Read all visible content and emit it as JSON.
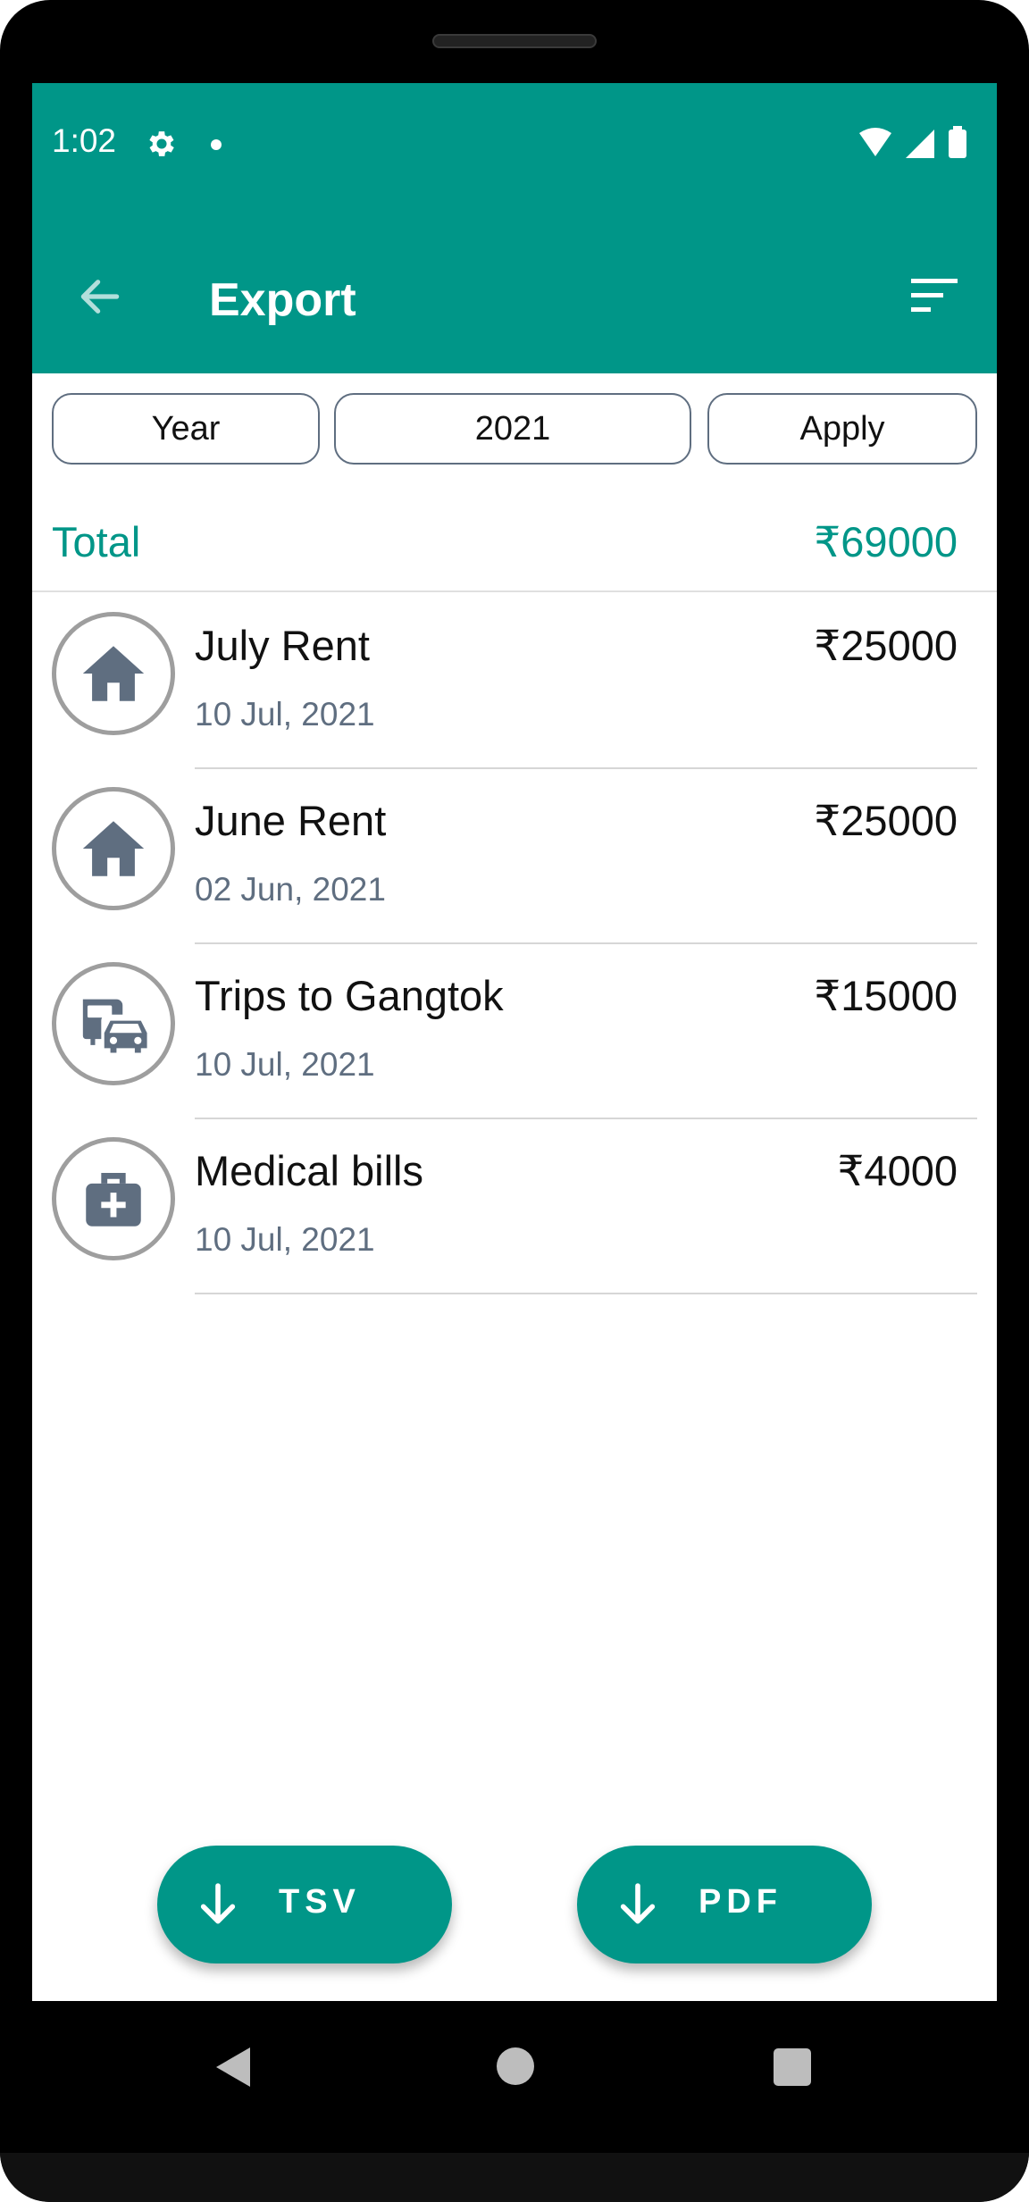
{
  "status_bar": {
    "time": "1:02",
    "icons": [
      "gear-icon",
      "notification-dot-icon",
      "wifi-icon",
      "signal-icon",
      "battery-icon"
    ]
  },
  "app_bar": {
    "title": "Export",
    "back_icon": "arrow-left-icon",
    "sort_icon": "sort-icon"
  },
  "filters": {
    "period": "Year",
    "value": "2021",
    "apply_label": "Apply"
  },
  "summary": {
    "total_label": "Total",
    "total_amount": "₹69000"
  },
  "expenses": [
    {
      "title": "July Rent",
      "date": "10 Jul, 2021",
      "amount": "₹25000",
      "icon": "house-icon"
    },
    {
      "title": "June Rent",
      "date": "02 Jun, 2021",
      "amount": "₹25000",
      "icon": "house-icon"
    },
    {
      "title": "Trips to Gangtok",
      "date": "10 Jul, 2021",
      "amount": "₹15000",
      "icon": "transport-icon"
    },
    {
      "title": "Medical bills",
      "date": "10 Jul, 2021",
      "amount": "₹4000",
      "icon": "medical-kit-icon"
    }
  ],
  "actions": {
    "tsv_label": "TSV",
    "pdf_label": "PDF"
  },
  "colors": {
    "primary": "#009688",
    "icon_gray": "#5f6e80",
    "text": "#111111"
  }
}
